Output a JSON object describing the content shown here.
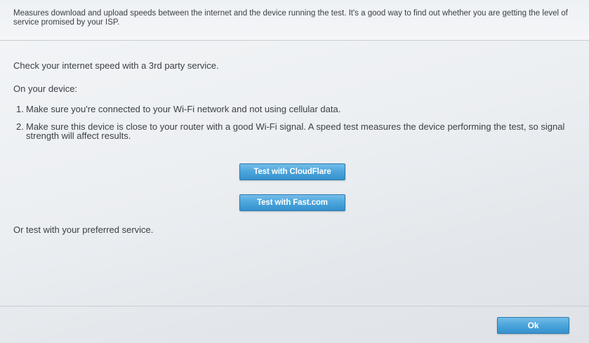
{
  "header": {
    "description": "Measures download and upload speeds between the internet and the device running the test. It's a good way to find out whether you are getting the level of service promised by your ISP."
  },
  "main": {
    "intro": "Check your internet speed with a 3rd party service.",
    "on_device_label": "On your device:",
    "steps": [
      {
        "number": "1.",
        "text": "Make sure you're connected to your Wi-Fi network and not using cellular data."
      },
      {
        "number": "2.",
        "text": "Make sure this device is close to your router with a good Wi-Fi signal. A speed test measures the device performing the test, so signal strength will affect results."
      }
    ],
    "cloudflare_button": "Test with CloudFlare",
    "fast_button": "Test with Fast.com",
    "preferred_service": "Or test with your preferred service."
  },
  "footer": {
    "ok_button": "Ok"
  },
  "colors": {
    "button_primary": "#4ea6dc",
    "button_border": "#2d7ab0",
    "text": "#3b4046"
  }
}
